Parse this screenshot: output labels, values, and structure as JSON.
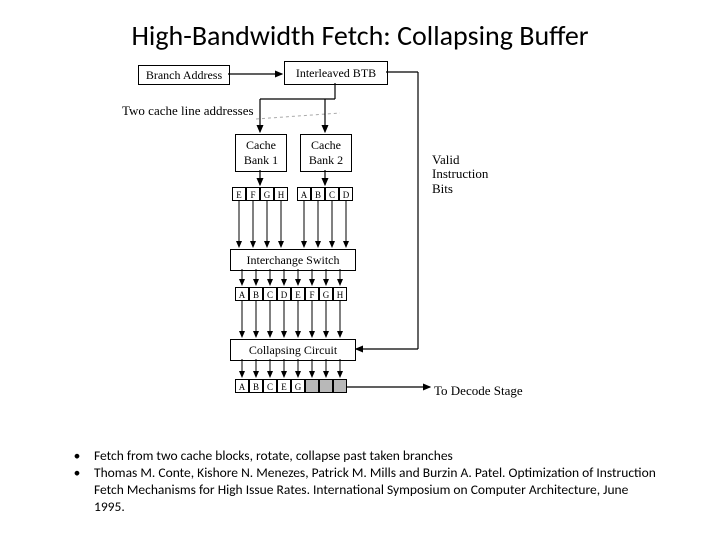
{
  "title": "High-Bandwidth Fetch: Collapsing Buffer",
  "labels": {
    "branch_address": "Branch Address",
    "interleaved_btb": "Interleaved BTB",
    "two_lines": "Two cache line addresses",
    "cache_bank_1": "Cache\nBank 1",
    "cache_bank_2": "Cache\nBank 2",
    "valid_bits": "Valid\nInstruction\nBits",
    "interchange_switch": "Interchange Switch",
    "collapsing_circuit": "Collapsing Circuit",
    "to_decode": "To Decode Stage"
  },
  "strips": {
    "bank1": [
      "E",
      "F",
      "G",
      "H"
    ],
    "bank2": [
      "A",
      "B",
      "C",
      "D"
    ],
    "after_switch": [
      "A",
      "B",
      "C",
      "D",
      "E",
      "F",
      "G",
      "H"
    ],
    "after_collapse": [
      "A",
      "B",
      "C",
      "E",
      "G",
      "",
      "",
      ""
    ],
    "after_collapse_shaded": [
      false,
      false,
      false,
      false,
      false,
      true,
      true,
      true
    ]
  },
  "bullets": [
    "Fetch from two cache blocks, rotate, collapse past taken branches",
    "Thomas M. Conte, Kishore N. Menezes, Patrick M. Mills and Burzin A. Patel. Optimization of Instruction Fetch Mechanisms for High Issue Rates. International Symposium on Computer Architecture, June 1995."
  ]
}
